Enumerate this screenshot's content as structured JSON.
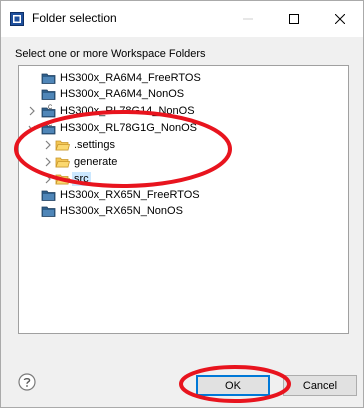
{
  "window": {
    "title": "Folder selection",
    "icon": "folder-selection-app-icon",
    "controls": {
      "minimize": "—",
      "maximize": "☐",
      "close": "✕"
    }
  },
  "section_label": "Select one or more Workspace Folders",
  "tree": {
    "items": [
      {
        "label": "HS300x_RA6M4_FreeRTOS",
        "icon": "project-folder-icon",
        "expandable": false,
        "indent": 0
      },
      {
        "label": "HS300x_RA6M4_NonOS",
        "icon": "project-folder-icon",
        "expandable": false,
        "indent": 0
      },
      {
        "label": "HS300x_RL78G14_NonOS",
        "icon": "c-project-icon",
        "expandable": true,
        "indent": 0
      },
      {
        "label": "HS300x_RL78G1G_NonOS",
        "icon": "c-project-icon",
        "expandable": true,
        "indent": 0,
        "expanded": true
      },
      {
        "label": ".settings",
        "icon": "folder-icon",
        "expandable": true,
        "indent": 1
      },
      {
        "label": "generate",
        "icon": "folder-icon",
        "expandable": true,
        "indent": 1
      },
      {
        "label": "src",
        "icon": "folder-icon",
        "expandable": true,
        "indent": 1,
        "selected": true
      },
      {
        "label": "HS300x_RX65N_FreeRTOS",
        "icon": "project-folder-icon",
        "expandable": false,
        "indent": 0
      },
      {
        "label": "HS300x_RX65N_NonOS",
        "icon": "project-folder-icon",
        "expandable": false,
        "indent": 0
      }
    ]
  },
  "buttons": {
    "ok": "OK",
    "cancel": "Cancel"
  },
  "help_icon": "help-icon",
  "annotation_color": "#e8141e",
  "colors": {
    "accent": "#0078d7",
    "folder": "#e8a82e",
    "project_folder": "#2f5f8a",
    "selection": "#cce8ff"
  }
}
